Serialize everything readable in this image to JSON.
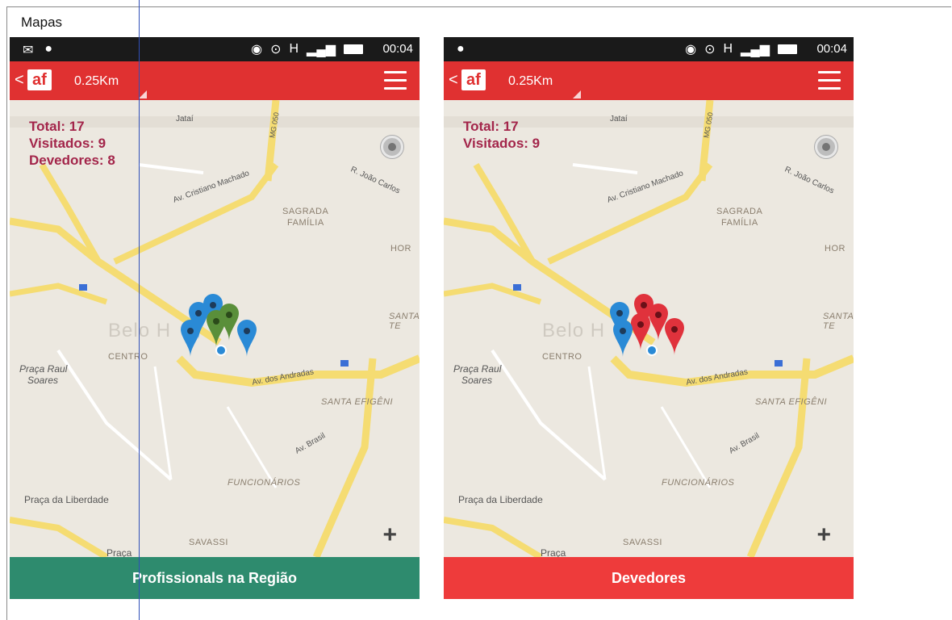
{
  "document": {
    "title": "Mapas"
  },
  "phones": [
    {
      "status_time": "00:04",
      "back_glyph": "<",
      "logo": "af",
      "distance": "0.25Km",
      "counts": [
        "Total: 17",
        "Visitados: 9",
        "Devedores: 8"
      ],
      "bottom_button": "Profissionals na Região",
      "bottom_color": "#2e8b6e",
      "pins": [
        "blue",
        "blue",
        "blue",
        "blue",
        "green",
        "green",
        "blue"
      ]
    },
    {
      "status_time": "00:04",
      "back_glyph": "<",
      "logo": "af",
      "distance": "0.25Km",
      "counts": [
        "Total: 17",
        "Visitados: 9"
      ],
      "bottom_button": "Devedores",
      "bottom_color": "#ee3b3b",
      "pins": [
        "blue",
        "red",
        "red",
        "red",
        "blue",
        "red",
        "red"
      ]
    }
  ],
  "map_labels": {
    "belo": "Belo H",
    "centro": "CENTRO",
    "praca_raul": "Praça Raul",
    "soares": "Soares",
    "santa_efigenia": "SANTA EFIGÊNI",
    "funcionarios": "FUNCIONÁRIOS",
    "praca_liberdade": "Praça da Liberdade",
    "savassi": "SAVASSI",
    "sagrada": "SAGRADA",
    "familia": "FAMÍLIA",
    "santa_tereza": "SANTA TE",
    "hor": "HOR",
    "av_cristiano": "Av. Cristiano Machado",
    "av_andradas": "Av. dos Andradas",
    "av_brasil": "Av. Brasil",
    "mg050": "MG 050",
    "r_joao": "R. João Carlos",
    "jatai": "Jataí",
    "praca": "Praça"
  },
  "colors": {
    "appbar": "#e03131",
    "marker_blue": "#2a8ad6",
    "marker_green": "#5a8f3a",
    "marker_red": "#e0323c"
  },
  "icons": {
    "zoom": "plus-icon",
    "locate": "my-location-icon",
    "menu": "hamburger-menu-icon"
  }
}
